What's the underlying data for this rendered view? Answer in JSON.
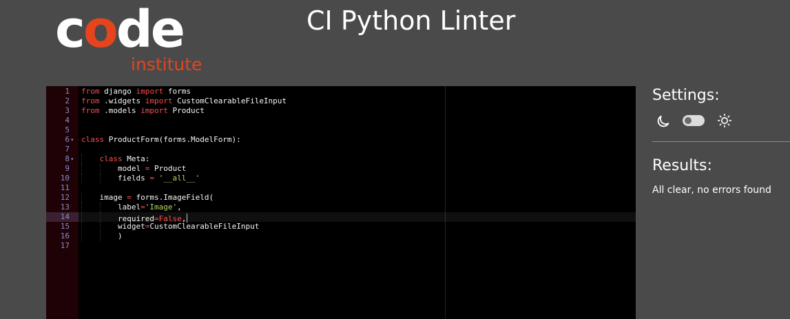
{
  "app": {
    "title": "CI Python Linter",
    "logo": {
      "word_prefix": "c",
      "word_o": "o",
      "word_suffix": "de",
      "tagline": "institute"
    }
  },
  "colors": {
    "background": "#4a4a4a",
    "brand_orange": "#e5441c",
    "keyword": "#ff4c4c",
    "string": "#b5d95f",
    "line_number": "#8a8fce",
    "gutter": "#1e0206",
    "editor_background": "#000000"
  },
  "editor": {
    "active_line": 14,
    "lines": [
      {
        "number": "1",
        "fold": false,
        "indent": 0,
        "tokens": [
          {
            "t": "keyword",
            "v": "from"
          },
          {
            "t": "text",
            "v": " django "
          },
          {
            "t": "keyword",
            "v": "import"
          },
          {
            "t": "text",
            "v": " forms"
          }
        ]
      },
      {
        "number": "2",
        "fold": false,
        "indent": 0,
        "tokens": [
          {
            "t": "keyword",
            "v": "from"
          },
          {
            "t": "text",
            "v": " .widgets "
          },
          {
            "t": "keyword",
            "v": "import"
          },
          {
            "t": "text",
            "v": " CustomClearableFileInput"
          }
        ]
      },
      {
        "number": "3",
        "fold": false,
        "indent": 0,
        "tokens": [
          {
            "t": "keyword",
            "v": "from"
          },
          {
            "t": "text",
            "v": " .models "
          },
          {
            "t": "keyword",
            "v": "import"
          },
          {
            "t": "text",
            "v": " Product"
          }
        ]
      },
      {
        "number": "4",
        "fold": false,
        "indent": 0,
        "tokens": []
      },
      {
        "number": "5",
        "fold": false,
        "indent": 0,
        "tokens": []
      },
      {
        "number": "6",
        "fold": true,
        "indent": 0,
        "tokens": [
          {
            "t": "keyword",
            "v": "class"
          },
          {
            "t": "text",
            "v": " ProductForm(forms.ModelForm):"
          }
        ]
      },
      {
        "number": "7",
        "fold": false,
        "indent": 0,
        "tokens": []
      },
      {
        "number": "8",
        "fold": true,
        "indent": 1,
        "tokens": [
          {
            "t": "keyword",
            "v": "class"
          },
          {
            "t": "text",
            "v": " Meta:"
          }
        ]
      },
      {
        "number": "9",
        "fold": false,
        "indent": 2,
        "tokens": [
          {
            "t": "text",
            "v": "model "
          },
          {
            "t": "keyword",
            "v": "="
          },
          {
            "t": "text",
            "v": " Product"
          }
        ]
      },
      {
        "number": "10",
        "fold": false,
        "indent": 2,
        "tokens": [
          {
            "t": "text",
            "v": "fields "
          },
          {
            "t": "keyword",
            "v": "="
          },
          {
            "t": "text",
            "v": " "
          },
          {
            "t": "string",
            "v": "'__all__'"
          }
        ]
      },
      {
        "number": "11",
        "fold": false,
        "indent": 0,
        "tokens": []
      },
      {
        "number": "12",
        "fold": false,
        "indent": 1,
        "tokens": [
          {
            "t": "text",
            "v": "image "
          },
          {
            "t": "keyword",
            "v": "="
          },
          {
            "t": "text",
            "v": " forms.ImageField("
          }
        ]
      },
      {
        "number": "13",
        "fold": false,
        "indent": 2,
        "tokens": [
          {
            "t": "text",
            "v": "label"
          },
          {
            "t": "keyword",
            "v": "="
          },
          {
            "t": "string",
            "v": "'Image'"
          },
          {
            "t": "text",
            "v": ","
          }
        ]
      },
      {
        "number": "14",
        "fold": false,
        "indent": 2,
        "tokens": [
          {
            "t": "text",
            "v": "required"
          },
          {
            "t": "keyword",
            "v": "=False"
          },
          {
            "t": "text",
            "v": ","
          }
        ]
      },
      {
        "number": "15",
        "fold": false,
        "indent": 2,
        "tokens": [
          {
            "t": "text",
            "v": "widget"
          },
          {
            "t": "keyword",
            "v": "="
          },
          {
            "t": "text",
            "v": "CustomClearableFileInput"
          }
        ]
      },
      {
        "number": "16",
        "fold": false,
        "indent": 2,
        "tokens": [
          {
            "t": "text",
            "v": ")"
          }
        ]
      },
      {
        "number": "17",
        "fold": false,
        "indent": 0,
        "tokens": []
      }
    ]
  },
  "settings": {
    "title": "Settings:",
    "dark_icon": "moon-icon",
    "light_icon": "sun-icon",
    "toggle_state": "dark"
  },
  "results": {
    "title": "Results:",
    "message": "All clear, no errors found"
  }
}
